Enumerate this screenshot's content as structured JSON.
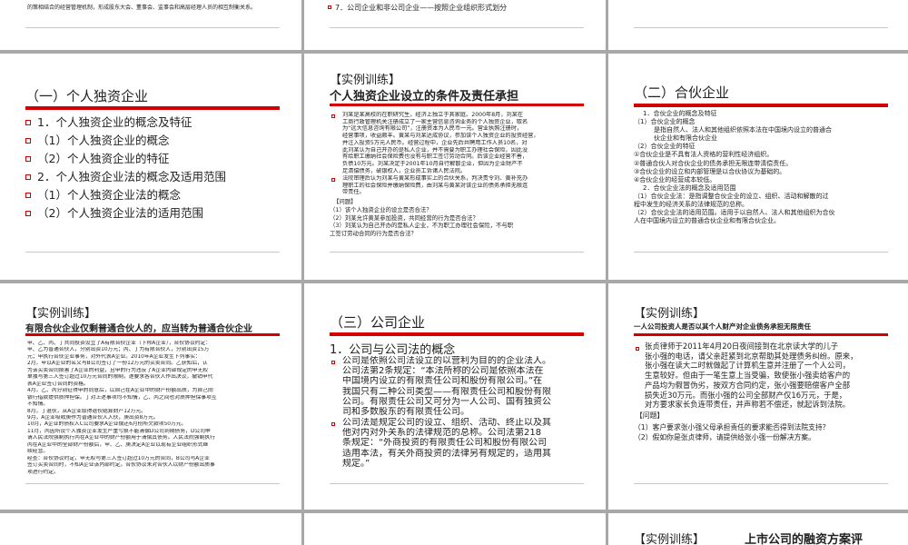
{
  "slide1": {
    "fragment": "的策相结合的经营管理机制，形成股东大会、董事会、监事会和高层经理人员的相互制衡关系。"
  },
  "slide2": {
    "item": "7．公司企业和非公司企业——按照企业组织形式划分"
  },
  "slide4": {
    "title": "（一）个人独资企业",
    "items": [
      "1．个人独资企业的概念及特征",
      "（1）个人独资企业的概念",
      "（2）个人独资企业的特征",
      "2．个人独资企业法的概念及适用范围",
      "（1）个人独资企业法的概念",
      "（2）个人独资企业法的适用范围"
    ]
  },
  "slide5": {
    "heading": "【实例训练】",
    "subtitle": "个人独资企业设立的条件及责任承担",
    "case": [
      "刘某是某高校的在职研究生，经济上独立于其家庭。2000年8月，刘某在",
      "工商行政管理机关注册成立了一家主营信息咨询业务的个人独资企业，取名",
      "为“远大信息咨询有限公司”，注册资本为人民币一元。营业执照注册时，",
      "经营事项，收益颇丰。黄某与刘某达成协议，参加该个人独资企业的投资经营，",
      "并注入投资5万元人民币。经营过程中，企业先后共聘用工作人员10名，对",
      "此刘某认为自己开办的是私人企业，并不需要为职工办理社会保险，因此没",
      "有给职工缴纳社会保险费也没有与职工签订劳动合同。后该企业经营不善，",
      "负债10万元。刘某决定于2001年10月自行解散企业，但因为企业财产不",
      "足清偿债务，破银权人，企业员工诉诸人民法院。"
    ],
    "court": [
      "法院审理后认为刘某与黄某形成事实上的合伙关系，判决责令刘、黄补充办",
      "理职工的社会保险并缴纳保险费，由刘某与黄某对该企业的债务承担无限连",
      "带责任。"
    ],
    "question_label": "【问题】",
    "questions": [
      "（1）该个人独资企业的设立是否合法？",
      "（2）刘某允许黄某参加投资，共同经营的行为是否合法？",
      "（3）刘某认为自己开办的是私人企业，不为职工办理社会保险，不与职",
      "工签订劳动合同的行为是否合法？"
    ]
  },
  "slide6": {
    "title": "（二）合伙企业",
    "lines": [
      "1．合伙企业的概念及特征",
      "（1）合伙企业的概念",
      "是指自然人、法人和其他组织依照本法在中国境内设立的普通合",
      "伙企业和有限合伙企业",
      "（2）合伙企业的特征",
      "①合伙企业是不具有法人资格的营利性经济组织。",
      "②普通合伙人对合伙企业的债务承担无限连带清偿责任。",
      "③合伙企业的设立和内部管理是以合伙协议为基础的。",
      "④合伙企业的经营成本较低。",
      "2．合伙企业法的概念及适用范围",
      "（1）合伙企业法：是指调整合伙企业的设立、组织、活动和解散的过",
      "程中发生的经济关系的法律规范的总称。",
      "（2）合伙企业法的适用范围。适用于以自然人、法人和其他组织为合伙",
      "人在中国境内设立的普通合伙企业和有限合伙企业。"
    ]
  },
  "slide7": {
    "heading": "【实例训练】",
    "subtitle": "有限合伙企业仅剩普通合伙人的，应当转为普通合伙企业",
    "lines": [
      "甲、乙、丙、丁共同投资设立了A有限合伙企业（下称A企业），合伙协议约定：",
      "甲、乙为普通合伙人，分别出资10万元；丙、丁为有限合伙人，分别出资15万",
      "元；甲执行合伙企业事务，对外代表A企业。2010年A企业发生下列事实：",
      "2月，甲以A企业的名义与B公司签订了一份12万元的买卖合同。乙获知后，认",
      "为该买卖合同损害了A企业的利益，且甲的行为违反了A企业内部规定的甲无权",
      "单独与第三人签订超过10万元合同的限制，遂要求各合伙人作出决议，撤销甲代",
      "表A企业签订合同的资格。",
      "4月，乙、丙分别征得甲的同意后，以自己在A企业中的财产份额出质，为自己向",
      "银行借款提供质押担保。丁对上述事项均不知情，乙、丙之间也对质押担保事项互",
      "不知情。",
      "8月，丁退伙，从A企业取得退伙结算财产12万元。",
      "9月，A企业吸收庚作为普通合伙人入伙，庚出资8万元。",
      "10月，A企业的债权人C公司要求A企业偿还6月份所欠款项50万元。",
      "11月，丙因所设个人独资企业发生严重亏损不能清偿D公司到期债务，D公司申",
      "请人民法院强制执行丙在A企业中的财产份额用于清偿其债务。人民法院强制执行",
      "丙在A企业中的全部财产份额后，甲、乙、庚决定A企业以现有企业组织形式继",
      "续经营。",
      "经查：合伙协议约定，甲无权与第三人签订超过10万元的合同，B公司与A企业",
      "签订买卖合同时，不知A企业该内部约定。合伙协议未对合伙人以财产份额出质事",
      "项进行约定。"
    ]
  },
  "slide8": {
    "title": "（三）公司企业",
    "section": "1．公司与公司法的概念",
    "para1": [
      "公司是依照公司法设立的以营利为目的的企业法人。",
      "公司法第2条规定：“本法所称的公司是依照本法在",
      "中国境内设立的有限责任公司和股份有限公司。”在",
      "我国只有二种公司类型——有限责任公司和股份有限",
      "公司。有限责任公司又可分为一人公司、国有独资公",
      "司和多数股东的有限责任公司。"
    ],
    "para2": [
      "公司法是规定公司的设立、组织、活动、终止以及其",
      "他对内对外关系的法律规范的总称。公司法第218",
      "条规定：“外商投资的有限责任公司和股份有限公司",
      "适用本法，有关外商投资的法律另有规定的，适用其",
      "规定。”"
    ]
  },
  "slide9": {
    "heading": "【实例训练】",
    "subtitle": "一人公司投资人是否以其个人财产对企业债务承担无限责任",
    "lines": [
      "张贞律师于2011年4月20日夜间接到在北京读大学的儿子",
      "张小强的电话，请父亲赶紧到北京帮助其处理债务纠纷。原来，",
      "张小强在读大二时就做起了计算机生意并注册了一个人公司，",
      "生意较好。但由于一笔生意上当受骗，致使张小强卖给客户的",
      "产品均为假冒伪劣，按双方合同约定，张小强要赔偿客户全部",
      "损失近30万元。而张小强的公司全部财产仅16万元，于是，",
      "对方要求家长负连带责任，并声称若不偿还，就起诉到法院。"
    ],
    "question_label": "【问题】",
    "questions": [
      "（1）客户要求张小强父母承担责任的要求能否得到法院支持？",
      "（2）假如你是张贞律师，请提供给张小强一份解决方案。"
    ]
  },
  "slide12": {
    "heading": "【实例训练】",
    "subtitle": "上市公司的融资方案评"
  }
}
